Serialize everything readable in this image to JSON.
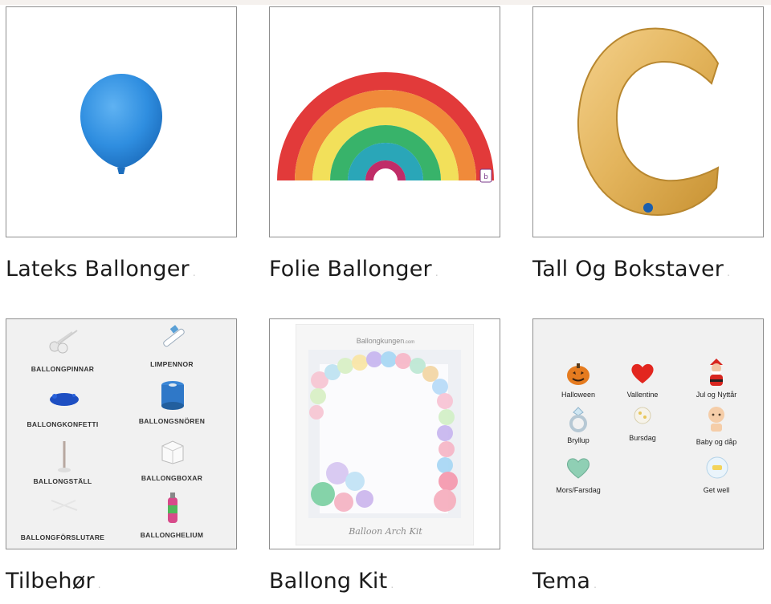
{
  "categories": [
    {
      "title": "Lateks Ballonger",
      "image": "blue-latex-balloon-icon"
    },
    {
      "title": "Folie Ballonger",
      "image": "rainbow-foil-balloon-icon"
    },
    {
      "title": "Tall Og Bokstaver",
      "image": "gold-letter-c-balloon-icon"
    },
    {
      "title": "Tilbehør",
      "image": "accessories-grid"
    },
    {
      "title": "Ballong Kit",
      "image": "balloon-arch-kit-box"
    },
    {
      "title": "Tema",
      "image": "theme-grid"
    }
  ],
  "accessories": [
    "BALLONGPINNAR",
    "LIMPENNOR",
    "BALLONGKONFETTI",
    "BALLONGSNÖREN",
    "BALLONGSTÄLL",
    "BALLONGBOXAR",
    "BALLONGFÖRSLUTARE",
    "BALLONGHELIUM"
  ],
  "kit": {
    "brand": "Ballongkungen",
    "brand_sub": ".com",
    "caption": "Balloon Arch Kit"
  },
  "themes": [
    "Halloween",
    "Vallentine",
    "Jul og Nyttår",
    "Bryllup",
    "Bursdag",
    "Baby og dåp",
    "Mors/Farsdag",
    "Get well"
  ],
  "colors": {
    "title": "#1b1b1b",
    "border": "#8f8f8f",
    "tile_grey": "#f1f1f1",
    "balloon_blue": "#2f8ee0",
    "gold": "#e3b45c"
  }
}
